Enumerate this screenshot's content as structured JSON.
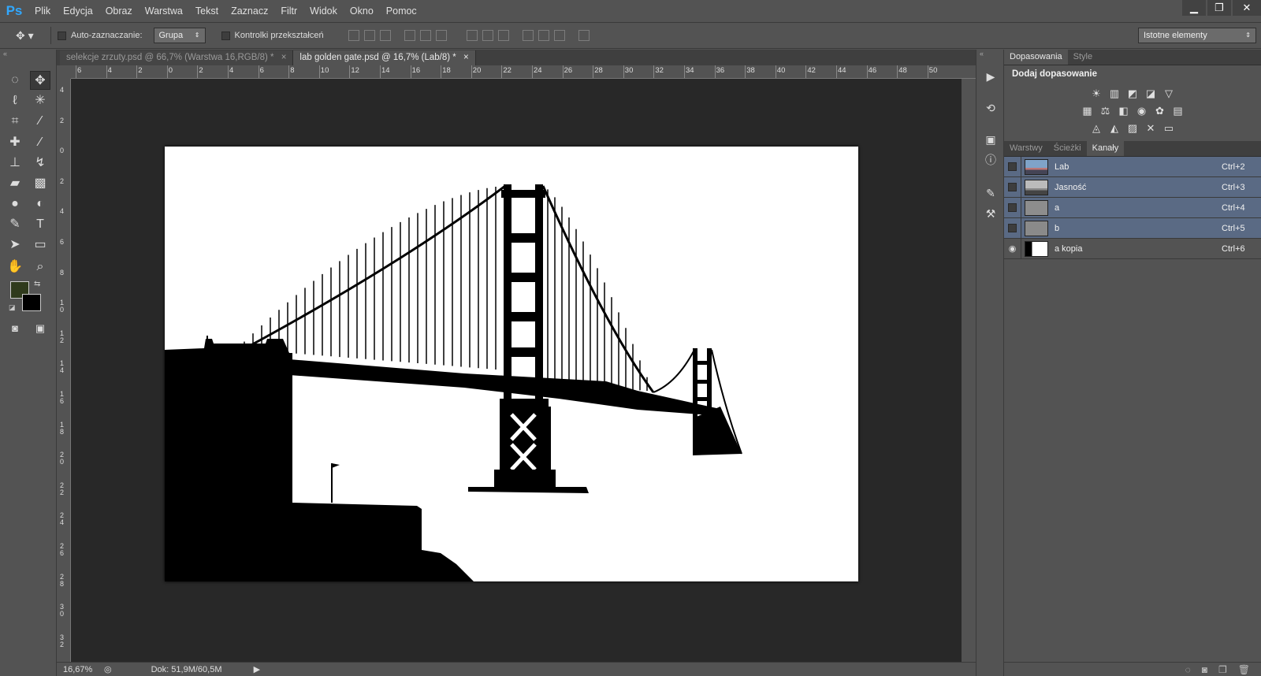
{
  "app": {
    "logo": "Ps"
  },
  "menu": [
    "Plik",
    "Edycja",
    "Obraz",
    "Warstwa",
    "Tekst",
    "Zaznacz",
    "Filtr",
    "Widok",
    "Okno",
    "Pomoc"
  ],
  "window_controls": {
    "minimize": "▁",
    "restore": "❐",
    "close": "✕"
  },
  "options": {
    "auto_select_label": "Auto-zaznaczanie:",
    "auto_select_value": "Grupa",
    "transform_label": "Kontrolki przekształceń",
    "workspace": "Istotne elementy"
  },
  "tabs": [
    {
      "label": "selekcje zrzuty.psd @ 66,7% (Warstwa 16,RGB/8) *",
      "close": "×"
    },
    {
      "label": "lab golden gate.psd @ 16,7% (Lab/8) *",
      "close": "×"
    }
  ],
  "ruler_h": [
    "6",
    "4",
    "2",
    "0",
    "2",
    "4",
    "6",
    "8",
    "10",
    "12",
    "14",
    "16",
    "18",
    "20",
    "22",
    "24",
    "26",
    "28",
    "30",
    "32",
    "34",
    "36",
    "38",
    "40",
    "42",
    "44",
    "46",
    "48",
    "50"
  ],
  "ruler_v": [
    "4",
    "2",
    "0",
    "2",
    "4",
    "6",
    "8",
    "1 0",
    "1 2",
    "1 4",
    "1 6",
    "1 8",
    "2 0",
    "2 2",
    "2 4",
    "2 6",
    "2 8",
    "3 0",
    "3 2"
  ],
  "status": {
    "zoom": "16,67%",
    "doc": "Dok: 51,9M/60,5M"
  },
  "adjustments": {
    "tabs": [
      "Dopasowania",
      "Style"
    ],
    "title": "Dodaj dopasowanie",
    "row1": [
      "☀",
      "▥",
      "◩",
      "◪",
      "▽"
    ],
    "row2": [
      "▦",
      "⚖",
      "◧",
      "◉",
      "✿",
      "▤"
    ],
    "row3": [
      "◬",
      "◭",
      "▨",
      "✕",
      "▭"
    ]
  },
  "channels": {
    "tabs": [
      "Warstwy",
      "Ścieżki",
      "Kanały"
    ],
    "rows": [
      {
        "name": "Lab",
        "key": "Ctrl+2",
        "visible": false,
        "selected": true
      },
      {
        "name": "Jasność",
        "key": "Ctrl+3",
        "visible": false,
        "selected": true
      },
      {
        "name": "a",
        "key": "Ctrl+4",
        "visible": false,
        "selected": true
      },
      {
        "name": "b",
        "key": "Ctrl+5",
        "visible": false,
        "selected": true
      },
      {
        "name": "a kopia",
        "key": "Ctrl+6",
        "visible": true,
        "selected": false
      }
    ]
  },
  "colors": {
    "foreground": "#2f3a1c",
    "background": "#000000",
    "accent": "#5a6a84"
  }
}
